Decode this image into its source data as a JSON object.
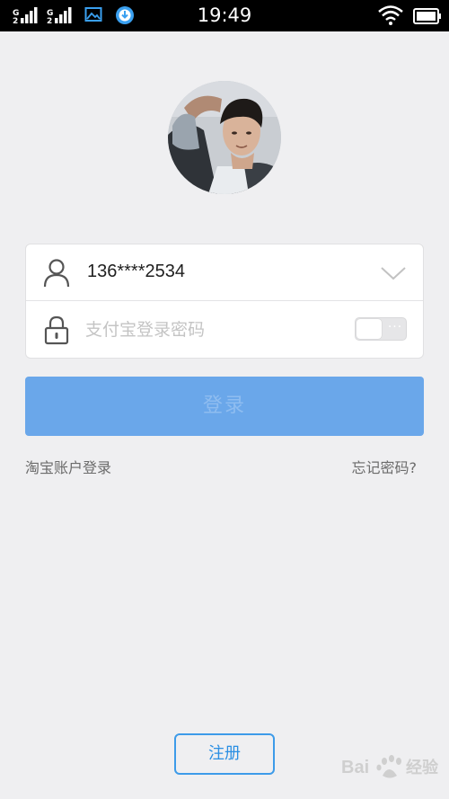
{
  "status_bar": {
    "time": "19:49",
    "icons": [
      "signal-icon",
      "signal-icon",
      "image-notification-icon",
      "download-notification-icon",
      "wifi-icon",
      "battery-icon"
    ]
  },
  "avatar": {
    "icon": "user-avatar"
  },
  "login_form": {
    "account": {
      "icon": "user-icon",
      "value": "136****2534",
      "dropdown_icon": "chevron-down-icon"
    },
    "password": {
      "icon": "lock-icon",
      "placeholder": "支付宝登录密码",
      "visibility_toggle_label": "···"
    },
    "login_button": "登录"
  },
  "links": {
    "taobao_login": "淘宝账户登录",
    "forgot_password": "忘记密码?"
  },
  "register_button": "注册",
  "watermark": {
    "text": "Bai 经验"
  },
  "colors": {
    "background": "#efeff1",
    "primary": "#6aa7ea",
    "register_border": "#3d9be9",
    "link_text": "#6b6b6b"
  }
}
